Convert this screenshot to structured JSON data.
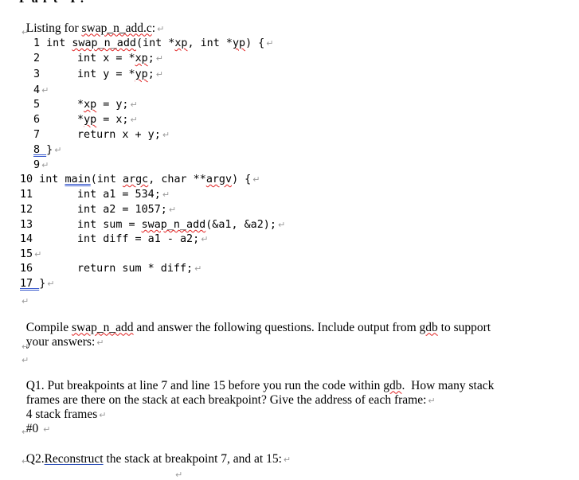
{
  "heading_fragment": "Part I:",
  "intro": {
    "prefix": "Listing for ",
    "filename": "swap_n_add.c",
    "suffix": ":"
  },
  "code": [
    {
      "n": "1",
      "pre": " int ",
      "name": "swap_n_add",
      "rest": "(int *xp, int *yp) {"
    },
    {
      "n": "2",
      "text": "int x = *xp;"
    },
    {
      "n": "3",
      "text": "int y = *yp;"
    },
    {
      "n": "4",
      "text": ""
    },
    {
      "n": "5",
      "text": "*xp = y;"
    },
    {
      "n": "6",
      "text": "*yp = x;"
    },
    {
      "n": "7",
      "text": "return x + y;"
    },
    {
      "n": "8",
      "text": "}"
    },
    {
      "n": "9",
      "text": ""
    },
    {
      "n": "10",
      "pre": " int ",
      "name": "main",
      "rest": "(int argc, char **argv) {"
    },
    {
      "n": "11",
      "text": "int a1 = 534;"
    },
    {
      "n": "12",
      "text": "int a2 = 1057;"
    },
    {
      "n": "13",
      "text": "int sum = swap_n_add(&a1, &a2);"
    },
    {
      "n": "14",
      "text": "int diff = a1 - a2;"
    },
    {
      "n": "15",
      "text": ""
    },
    {
      "n": "16",
      "text": "return sum * diff;"
    },
    {
      "n": "17",
      "text": "}"
    }
  ],
  "compile": {
    "line1": "Compile swap_n_add and answer the following questions. Include output from gdb to support",
    "line2": "your answers:"
  },
  "q1": {
    "line1": "Q1. Put breakpoints at line 7 and line 15 before you run the code within gdb.  How many stack",
    "line2": "frames are there on the stack at each breakpoint? Give the address of each frame:",
    "answer1": "4 stack frames",
    "answer2": "#0 "
  },
  "q2": {
    "prefix": "Q2.",
    "word": "Reconstruct",
    "rest": " the stack at breakpoint 7, and at 15:"
  },
  "paragraph_mark": "↵"
}
